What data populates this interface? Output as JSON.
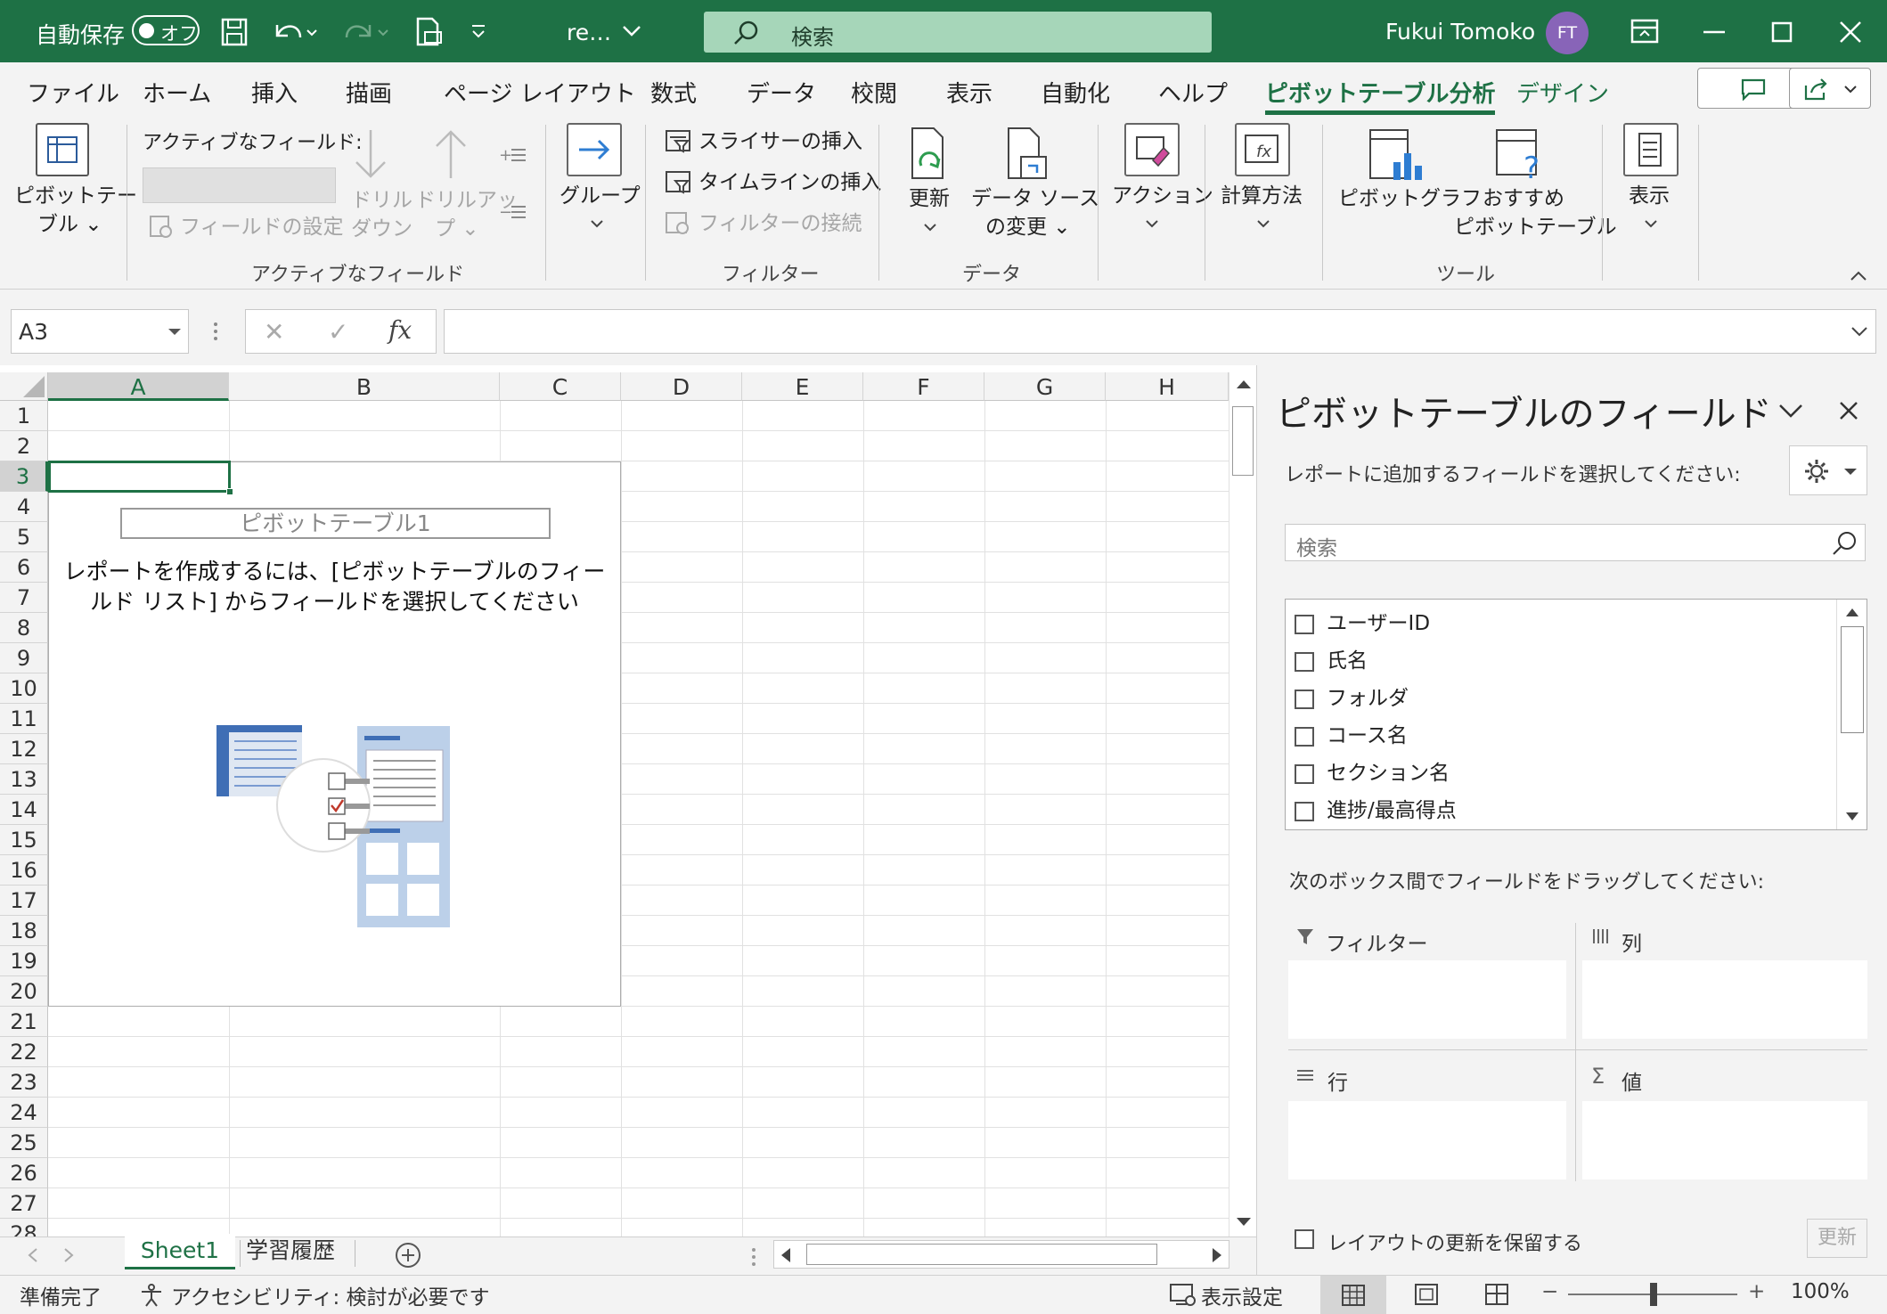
{
  "titlebar": {
    "autosave_label": "自動保存",
    "autosave_state": "オフ",
    "filename": "re…",
    "search_placeholder": "検索",
    "user_name": "Fukui Tomoko",
    "user_initials": "FT"
  },
  "tabs": [
    "ファイル",
    "ホーム",
    "挿入",
    "描画",
    "ページ レイアウト",
    "数式",
    "データ",
    "校閲",
    "表示",
    "自動化",
    "ヘルプ",
    "ピボットテーブル分析",
    "デザイン"
  ],
  "active_tab": "ピボットテーブル分析",
  "ribbon": {
    "pivottable_label_1": "ピボットテー",
    "pivottable_label_2": "ブル ⌄",
    "active_field_label": "アクティブなフィールド:",
    "field_settings": "フィールドの設定",
    "drilldown_1": "ドリル",
    "drilldown_2": "ダウン",
    "drillup_1": "ドリルアッ",
    "drillup_2": "プ ⌄",
    "group_label": "グループ",
    "insert_slicer": "スライサーの挿入",
    "insert_timeline": "タイムラインの挿入",
    "filter_connections": "フィルターの接続",
    "refresh": "更新",
    "change_source_1": "データ ソース",
    "change_source_2": "の変更 ⌄",
    "actions": "アクション",
    "calculations": "計算方法",
    "pivotchart": "ピボットグラフ",
    "recommended_1": "おすすめ",
    "recommended_2": "ピボットテーブル",
    "show": "表示",
    "groups": {
      "active_field": "アクティブなフィールド",
      "filter": "フィルター",
      "data": "データ",
      "tools": "ツール"
    }
  },
  "formula_bar": {
    "name_box": "A3",
    "fx": "fx",
    "cancel": "✕",
    "enter": "✓",
    "formula": ""
  },
  "grid": {
    "columns": [
      "A",
      "B",
      "C",
      "D",
      "E",
      "F",
      "G",
      "H"
    ],
    "rows": [
      "1",
      "2",
      "3",
      "4",
      "5",
      "6",
      "7",
      "8",
      "9",
      "10",
      "11",
      "12",
      "13",
      "14",
      "15",
      "16",
      "17",
      "18",
      "19",
      "20",
      "21",
      "22",
      "23",
      "24",
      "25",
      "26",
      "27",
      "28"
    ],
    "selected_cell": "A3"
  },
  "pivot": {
    "name": "ピボットテーブル1",
    "message": "レポートを作成するには、[ピボットテーブルのフィールド リスト] からフィールドを選択してください"
  },
  "sheets": [
    "Sheet1",
    "学習履歴"
  ],
  "active_sheet": "Sheet1",
  "status": {
    "ready": "準備完了",
    "accessibility": "アクセシビリティ: 検討が必要です",
    "display_settings": "表示設定",
    "zoom": "100%"
  },
  "pane": {
    "title": "ピボットテーブルのフィールド",
    "instruction": "レポートに追加するフィールドを選択してください:",
    "search_placeholder": "検索",
    "fields": [
      "ユーザーID",
      "氏名",
      "フォルダ",
      "コース名",
      "セクション名",
      "進捗/最高得点"
    ],
    "drag_instruction": "次のボックス間でフィールドをドラッグしてください:",
    "zones": {
      "filter": "フィルター",
      "columns": "列",
      "rows": "行",
      "values": "値"
    },
    "defer_update": "レイアウトの更新を保留する",
    "update_button": "更新"
  },
  "colors": {
    "accent": "#1e7145",
    "search_bg": "#a6d6b9",
    "avatar": "#8864b8"
  }
}
